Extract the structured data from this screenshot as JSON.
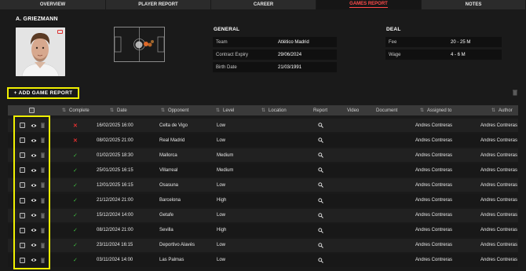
{
  "tabs": [
    {
      "label": "OVERVIEW",
      "active": false
    },
    {
      "label": "PLAYER REPORT",
      "active": false
    },
    {
      "label": "CAREER",
      "active": false
    },
    {
      "label": "GAMES REPORT",
      "active": true
    },
    {
      "label": "NOTES",
      "active": false
    }
  ],
  "player": {
    "name": "A. GRIEZMANN"
  },
  "general": {
    "title": "GENERAL",
    "fields": [
      {
        "label": "Team",
        "value": "Atlético Madrid"
      },
      {
        "label": "Contract Expiry",
        "value": "29/06/2024"
      },
      {
        "label": "Birth Date",
        "value": "21/03/1991"
      }
    ]
  },
  "deal": {
    "title": "DEAL",
    "fields": [
      {
        "label": "Fee",
        "value": "20 - 25 M"
      },
      {
        "label": "Wage",
        "value": "4 - 6 M"
      }
    ]
  },
  "add_button": {
    "label": "+ ADD GAME REPORT"
  },
  "table": {
    "columns": [
      "Complete",
      "Date",
      "Opponent",
      "Level",
      "Location",
      "Report",
      "Video",
      "Document",
      "Assigned to",
      "Author"
    ],
    "rows": [
      {
        "complete": false,
        "date": "16/02/2025 16:00",
        "opponent": "Celta de Vigo",
        "level": "Low",
        "assigned": "Andres Contreras",
        "author": "Andres Contreras"
      },
      {
        "complete": false,
        "date": "08/02/2025 21:00",
        "opponent": "Real Madrid",
        "level": "Low",
        "assigned": "Andres Contreras",
        "author": "Andres Contreras"
      },
      {
        "complete": true,
        "date": "01/02/2025 18:30",
        "opponent": "Mallorca",
        "level": "Medium",
        "assigned": "Andres Contreras",
        "author": "Andres Contreras"
      },
      {
        "complete": true,
        "date": "25/01/2025 16:15",
        "opponent": "Villarreal",
        "level": "Medium",
        "assigned": "Andres Contreras",
        "author": "Andres Contreras"
      },
      {
        "complete": true,
        "date": "12/01/2025 16:15",
        "opponent": "Osasuna",
        "level": "Low",
        "assigned": "Andres Contreras",
        "author": "Andres Contreras"
      },
      {
        "complete": true,
        "date": "21/12/2024 21:00",
        "opponent": "Barcelona",
        "level": "High",
        "assigned": "Andres Contreras",
        "author": "Andres Contreras"
      },
      {
        "complete": true,
        "date": "15/12/2024 14:00",
        "opponent": "Getafe",
        "level": "Low",
        "assigned": "Andres Contreras",
        "author": "Andres Contreras"
      },
      {
        "complete": true,
        "date": "08/12/2024 21:00",
        "opponent": "Sevilla",
        "level": "High",
        "assigned": "Andres Contreras",
        "author": "Andres Contreras"
      },
      {
        "complete": true,
        "date": "23/11/2024 16:15",
        "opponent": "Deportivo Alavés",
        "level": "Low",
        "assigned": "Andres Contreras",
        "author": "Andres Contreras"
      },
      {
        "complete": true,
        "date": "03/11/2024 14:00",
        "opponent": "Las Palmas",
        "level": "Low",
        "assigned": "Andres Contreras",
        "author": "Andres Contreras"
      }
    ]
  },
  "colors": {
    "accent": "#ff4a4a",
    "highlight": "#f0f000",
    "complete": "#3fbf3f",
    "incomplete": "#e53030"
  },
  "icons": {
    "view": "eye-icon",
    "delete": "trash-icon",
    "report": "search-icon"
  }
}
